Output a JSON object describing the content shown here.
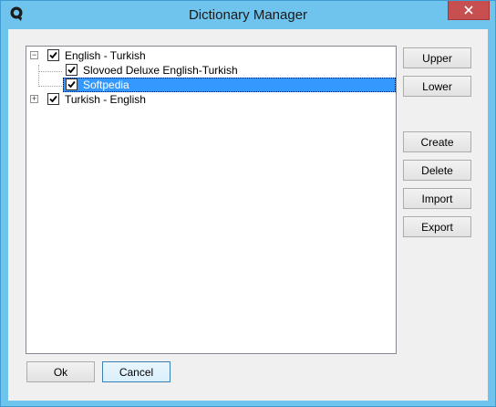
{
  "window": {
    "title": "Dictionary Manager",
    "close_symbol": "✕",
    "colors": {
      "frame": "#6fc4ee",
      "close": "#c74f50",
      "selection": "#3399ff"
    }
  },
  "tree": {
    "items": [
      {
        "label": "English - Turkish",
        "checked": true,
        "expanded": true,
        "expander": "−"
      },
      {
        "label": "Slovoed Deluxe English-Turkish",
        "checked": true
      },
      {
        "label": "Softpedia",
        "checked": true,
        "selected": true
      },
      {
        "label": "Turkish - English",
        "checked": true,
        "expanded": false,
        "expander": "+"
      }
    ]
  },
  "buttons": {
    "upper": "Upper",
    "lower": "Lower",
    "create": "Create",
    "delete": "Delete",
    "import": "Import",
    "export": "Export",
    "ok": "Ok",
    "cancel": "Cancel"
  }
}
